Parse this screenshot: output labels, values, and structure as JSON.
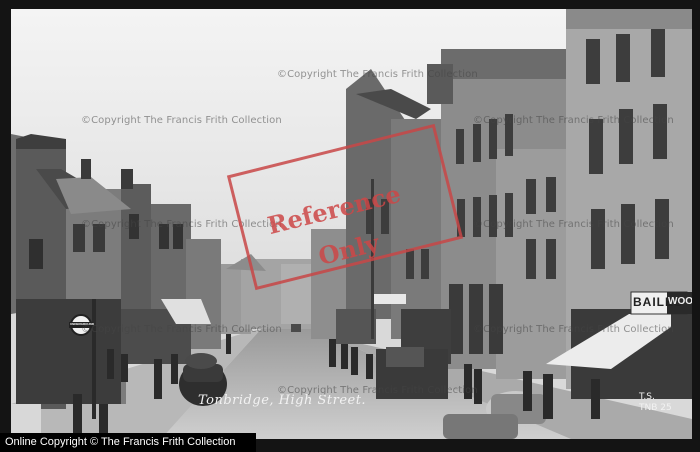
{
  "photo": {
    "caption": "Tonbridge, High Street.",
    "negative_id_line1": "T.S.",
    "negative_id_line2": "TNB 25",
    "shop_sign_bailes": "BAILES",
    "shop_sign_woolworth": "WOO",
    "underground_sign": "UNDERGROUND"
  },
  "watermarks": {
    "copyright_text": "©Copyright The Francis Frith Collection",
    "reference_stamp_line1": "Reference",
    "reference_stamp_line2": "Only"
  },
  "footer": {
    "copyright_bar": "Online Copyright © The Francis Frith Collection"
  },
  "colors": {
    "frame": "#141414",
    "stamp_red": "#cd4646",
    "sky": "#e6e6e6"
  }
}
